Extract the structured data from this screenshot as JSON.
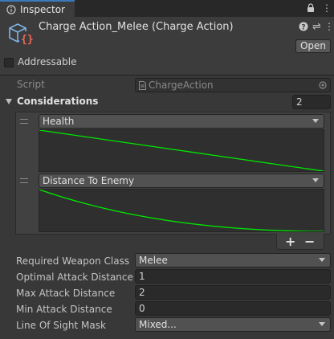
{
  "tab": {
    "label": "Inspector"
  },
  "header": {
    "title": "Charge Action_Melee (Charge Action)",
    "open_label": "Open"
  },
  "addressable": {
    "label": "Addressable",
    "checked": false
  },
  "script": {
    "label": "Script",
    "value": "ChargeAction"
  },
  "considerations": {
    "label": "Considerations",
    "count": "2",
    "items": [
      {
        "name": "Health",
        "curve": "linear-decreasing"
      },
      {
        "name": "Distance To Enemy",
        "curve": "ease-out-decreasing"
      }
    ],
    "add_label": "+",
    "remove_label": "−"
  },
  "properties": [
    {
      "label": "Required Weapon Class",
      "value": "Melee",
      "kind": "dropdown"
    },
    {
      "label": "Optimal Attack Distance",
      "value": "1",
      "kind": "field"
    },
    {
      "label": "Max Attack Distance",
      "value": "2",
      "kind": "field"
    },
    {
      "label": "Min Attack Distance",
      "value": "0",
      "kind": "field"
    },
    {
      "label": "Line Of Sight Mask",
      "value": "Mixed...",
      "kind": "dropdown"
    }
  ],
  "colors": {
    "curve": "#00e600",
    "accent": "#3a79bb",
    "selection": "#2c5d87"
  }
}
